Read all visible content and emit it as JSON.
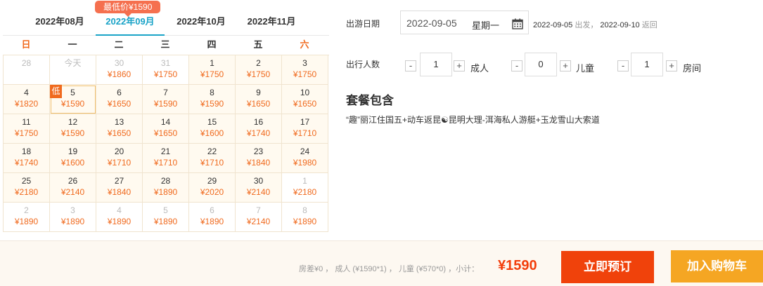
{
  "calendar": {
    "lowest_tip": "最低价¥1590",
    "months": [
      "2022年08月",
      "2022年09月",
      "2022年10月",
      "2022年11月"
    ],
    "active_month": 1,
    "weekdays": [
      "日",
      "一",
      "二",
      "三",
      "四",
      "五",
      "六"
    ],
    "low_badge": "低",
    "cells": [
      {
        "day": "28",
        "price": "",
        "muted": true
      },
      {
        "day": "今天",
        "price": "",
        "muted": true
      },
      {
        "day": "30",
        "price": "¥1860",
        "muted": true
      },
      {
        "day": "31",
        "price": "¥1750",
        "muted": true
      },
      {
        "day": "1",
        "price": "¥1750"
      },
      {
        "day": "2",
        "price": "¥1750"
      },
      {
        "day": "3",
        "price": "¥1750"
      },
      {
        "day": "4",
        "price": "¥1820"
      },
      {
        "day": "5",
        "price": "¥1590",
        "selected": true,
        "lowest": true
      },
      {
        "day": "6",
        "price": "¥1650"
      },
      {
        "day": "7",
        "price": "¥1590"
      },
      {
        "day": "8",
        "price": "¥1590"
      },
      {
        "day": "9",
        "price": "¥1650"
      },
      {
        "day": "10",
        "price": "¥1650"
      },
      {
        "day": "11",
        "price": "¥1750"
      },
      {
        "day": "12",
        "price": "¥1590"
      },
      {
        "day": "13",
        "price": "¥1650"
      },
      {
        "day": "14",
        "price": "¥1650"
      },
      {
        "day": "15",
        "price": "¥1600"
      },
      {
        "day": "16",
        "price": "¥1740"
      },
      {
        "day": "17",
        "price": "¥1710"
      },
      {
        "day": "18",
        "price": "¥1740"
      },
      {
        "day": "19",
        "price": "¥1600"
      },
      {
        "day": "20",
        "price": "¥1710"
      },
      {
        "day": "21",
        "price": "¥1710"
      },
      {
        "day": "22",
        "price": "¥1710"
      },
      {
        "day": "23",
        "price": "¥1840"
      },
      {
        "day": "24",
        "price": "¥1980"
      },
      {
        "day": "25",
        "price": "¥2180"
      },
      {
        "day": "26",
        "price": "¥2140"
      },
      {
        "day": "27",
        "price": "¥1840"
      },
      {
        "day": "28",
        "price": "¥1890"
      },
      {
        "day": "29",
        "price": "¥2020"
      },
      {
        "day": "30",
        "price": "¥2140"
      },
      {
        "day": "1",
        "price": "¥2180",
        "muted": true
      },
      {
        "day": "2",
        "price": "¥1890",
        "muted": true
      },
      {
        "day": "3",
        "price": "¥1890",
        "muted": true
      },
      {
        "day": "4",
        "price": "¥1890",
        "muted": true
      },
      {
        "day": "5",
        "price": "¥1890",
        "muted": true
      },
      {
        "day": "6",
        "price": "¥1890",
        "muted": true
      },
      {
        "day": "7",
        "price": "¥2140",
        "muted": true
      },
      {
        "day": "8",
        "price": "¥1890",
        "muted": true
      }
    ]
  },
  "booking": {
    "date_label": "出游日期",
    "date_value": "2022-09-05",
    "weekday_value": "星期一",
    "depart_date": "2022-09-05",
    "depart_word": "出发，",
    "return_date": "2022-09-10",
    "return_word": "返回",
    "people_label": "出行人数",
    "adults": {
      "value": "1",
      "unit": "成人"
    },
    "children": {
      "value": "0",
      "unit": "儿童"
    },
    "rooms": {
      "value": "1",
      "unit": "房间"
    },
    "minus": "-",
    "plus": "+"
  },
  "package": {
    "title": "套餐包含",
    "description": "“趣”丽江住国五+动车返昆☯昆明大理-洱海私人游艇+玉龙雪山大索道"
  },
  "footer": {
    "summary": "房差¥0 ， 成人 (¥1590*1) ， 儿童 (¥570*0) ，小计：",
    "total": "¥1590",
    "book_button": "立即预订",
    "cart_button": "加入购物车"
  },
  "colors": {
    "accent": "#1aa3c7",
    "price": "#f06a1e",
    "book": "#f0420b",
    "cart": "#f5a623"
  }
}
